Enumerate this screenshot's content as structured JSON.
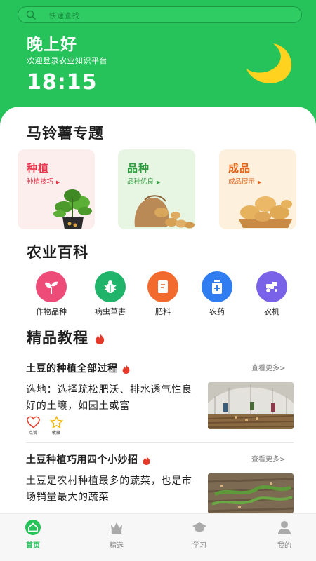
{
  "search": {
    "placeholder": "快速查找"
  },
  "header": {
    "greeting": "晚上好",
    "subtitle": "欢迎登录农业知识平台",
    "time": "18:15"
  },
  "topic_section": {
    "title": "马铃薯专题",
    "cards": [
      {
        "title": "种植",
        "subtitle": "种植技巧",
        "color": "#e8364a",
        "bg": "#fdeeee"
      },
      {
        "title": "品种",
        "subtitle": "品种优良",
        "color": "#2e9c3e",
        "bg": "#e7f5e3"
      },
      {
        "title": "成品",
        "subtitle": "成品展示",
        "color": "#e4651a",
        "bg": "#fdf0dd"
      }
    ]
  },
  "encyclopedia": {
    "title": "农业百科",
    "items": [
      {
        "label": "作物品种",
        "icon": "sprout-icon",
        "color": "#ee4c78"
      },
      {
        "label": "病虫草害",
        "icon": "bug-icon",
        "color": "#20b36a"
      },
      {
        "label": "肥料",
        "icon": "fertilizer-icon",
        "color": "#f26a2e"
      },
      {
        "label": "农药",
        "icon": "pesticide-icon",
        "color": "#2f7df0"
      },
      {
        "label": "农机",
        "icon": "tractor-icon",
        "color": "#7a62e8"
      }
    ]
  },
  "tutorials": {
    "title": "精品教程",
    "articles": [
      {
        "title": "土豆的种植全部过程",
        "more": "查看更多>",
        "text": "选地：选择疏松肥沃、排水透气性良好的土壤，如园土或富",
        "like_label": "点赞",
        "fav_label": "收藏"
      },
      {
        "title": "土豆种植巧用四个小妙招",
        "more": "查看更多>",
        "text": "土豆是农村种植最多的蔬菜，也是市场销量最大的蔬菜"
      }
    ]
  },
  "tabbar": {
    "active_color": "#25c35a",
    "items": [
      {
        "label": "首页",
        "icon": "home-icon"
      },
      {
        "label": "精选",
        "icon": "crown-icon"
      },
      {
        "label": "学习",
        "icon": "graduation-cap-icon"
      },
      {
        "label": "我的",
        "icon": "user-icon"
      }
    ]
  }
}
